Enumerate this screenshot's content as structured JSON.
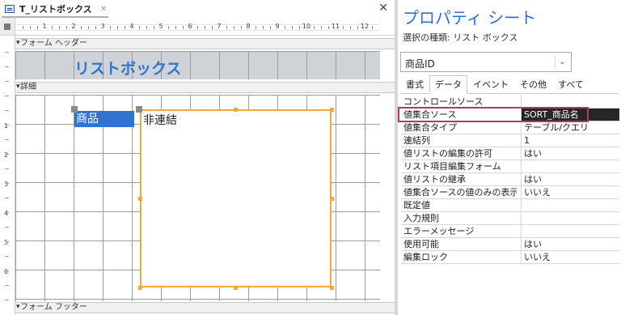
{
  "document": {
    "tab_title": "T_リストボックス",
    "tab_close_glyph": "✕",
    "close_glyph": "✕"
  },
  "ruler": {
    "numbers": [
      "1",
      "2",
      "3",
      "4",
      "5",
      "6",
      "7",
      "8",
      "9",
      "10",
      "11",
      "12"
    ],
    "vertical_numbers": [
      "1",
      "2",
      "3",
      "4",
      "5",
      "6"
    ]
  },
  "sections": {
    "form_header": "フォーム ヘッダー",
    "detail": "詳細",
    "form_footer": "フォーム フッター"
  },
  "form": {
    "header_title": "リストボックス",
    "label_text": "商品",
    "listbox_text": "非連結"
  },
  "property_sheet": {
    "title": "プロパティ シート",
    "selection_type": "選択の種類: リスト ボックス",
    "selected_control": "商品ID",
    "dropdown_glyph": "⌄",
    "tabs": [
      {
        "label": "書式",
        "active": false
      },
      {
        "label": "データ",
        "active": true
      },
      {
        "label": "イベント",
        "active": false
      },
      {
        "label": "その他",
        "active": false
      },
      {
        "label": "すべて",
        "active": false
      }
    ],
    "properties": [
      {
        "name": "コントロールソース",
        "value": ""
      },
      {
        "name": "値集合ソース",
        "value": "SORT_商品名",
        "selected": true
      },
      {
        "name": "値集合タイプ",
        "value": "テーブル/クエリ"
      },
      {
        "name": "連結列",
        "value": "1"
      },
      {
        "name": "値リストの編集の許可",
        "value": "はい"
      },
      {
        "name": "リスト項目編集フォーム",
        "value": ""
      },
      {
        "name": "値リストの継承",
        "value": "はい"
      },
      {
        "name": "値集合ソースの値のみの表示",
        "value": "いいえ"
      },
      {
        "name": "既定値",
        "value": ""
      },
      {
        "name": "入力規則",
        "value": ""
      },
      {
        "name": "エラーメッセージ",
        "value": ""
      },
      {
        "name": "使用可能",
        "value": "はい"
      },
      {
        "name": "編集ロック",
        "value": "いいえ"
      }
    ]
  },
  "colors": {
    "accent_blue": "#2e75d1",
    "selection_orange": "#f2a93b",
    "highlight_border": "#b23a5a"
  }
}
